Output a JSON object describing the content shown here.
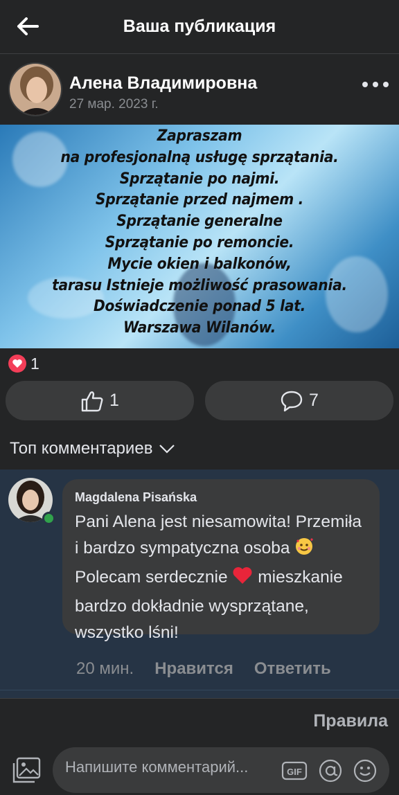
{
  "header": {
    "title": "Ваша публикация",
    "back_icon": "arrow-left-icon"
  },
  "post": {
    "author": "Алена Владимировна",
    "date": "27 мар. 2023 г.",
    "image_text": [
      "Zapraszam",
      "na profesjonalną usługę sprzątania.",
      "Sprzątanie po najmi.",
      "Sprzątanie przed najmem .",
      "Sprzątanie generalne",
      "Sprzątanie po remoncie.",
      "Mycie okien i balkonów,",
      "tarasu Istnieje możliwość prasowania.",
      "Doświadczenie ponad 5 lat.",
      "Warszawa Wilanów."
    ],
    "reaction_count": "1",
    "like_count": "1",
    "comment_count": "7"
  },
  "comments_section": {
    "sort_label": "Топ комментариев"
  },
  "comment": {
    "author": "Magdalena Pisańska",
    "text_part1": "Pani Alena jest niesamowita! Przemiła i bardzo sympatyczna osoba ",
    "text_part2": " Polecam serdecznie ",
    "text_part3": " mieszkanie bardzo dokładnie wysprzątane, wszystko lśni!",
    "time": "20 мин.",
    "like_label": "Нравится",
    "reply_label": "Ответить"
  },
  "bottom": {
    "rules_label": "Правила",
    "input_placeholder": "Напишите комментарий..."
  },
  "colors": {
    "background": "#242526",
    "comment_highlight": "#263445",
    "bubble": "#3a3b3c",
    "heart_red": "#f33e58",
    "online_green": "#31a24c"
  }
}
